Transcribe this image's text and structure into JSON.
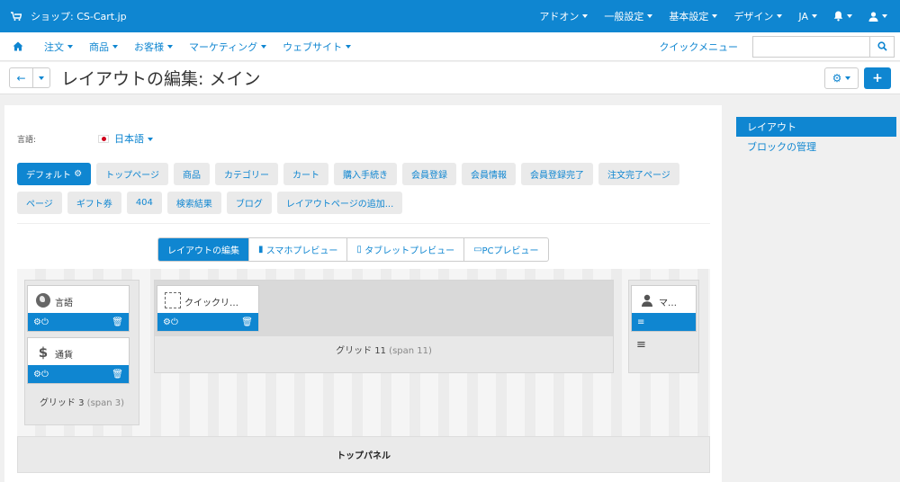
{
  "topbar": {
    "store": "ショップ: CS-Cart.jp",
    "menus": [
      "アドオン",
      "一般設定",
      "基本設定",
      "デザイン",
      "JA"
    ]
  },
  "nav": {
    "items": [
      "注文",
      "商品",
      "お客様",
      "マーケティング",
      "ウェブサイト"
    ],
    "quick_menu": "クイックメニュー",
    "search_placeholder": ""
  },
  "title": "レイアウトの編集: メイン",
  "language": {
    "label": "言語:",
    "value": "日本語"
  },
  "layout_tabs_row1": [
    "デフォルト",
    "トップページ",
    "商品",
    "カテゴリー",
    "カート",
    "購入手続き",
    "会員登録",
    "会員情報",
    "会員登録完了",
    "注文完了ページ"
  ],
  "layout_tabs_row2": [
    "ページ",
    "ギフト券",
    "404",
    "検索結果",
    "ブログ",
    "レイアウトページの追加..."
  ],
  "modes": [
    "レイアウトの編集",
    "スマホプレビュー",
    "タブレットプレビュー",
    "PCプレビュー"
  ],
  "grids": {
    "grid3_label": "グリッド 3",
    "grid3_span": "(span 3)",
    "grid11_label": "グリッド 11",
    "grid11_span": "(span 11)"
  },
  "blocks": {
    "language": "言語",
    "currency": "通貨",
    "quick": "クイックリ…",
    "account": "マ…"
  },
  "top_panel": "トップパネル",
  "sidebar": [
    "レイアウト",
    "ブロックの管理"
  ],
  "colors": {
    "primary": "#0f86d1"
  }
}
